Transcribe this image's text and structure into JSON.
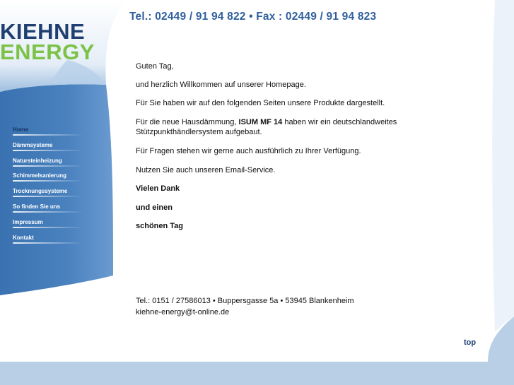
{
  "header": {
    "phone_fax": "Tel.: 02449 / 91 94 822  • Fax : 02449 / 91 94 823"
  },
  "logo": {
    "line1": "KIEHNE",
    "line2": "ENERGY"
  },
  "nav": {
    "items": [
      {
        "label": "Home"
      },
      {
        "label": "Dämmsysteme"
      },
      {
        "label": "Natursteinheizung"
      },
      {
        "label": "Schimmelsanierung"
      },
      {
        "label": "Trocknungssysteme"
      },
      {
        "label": "So finden Sie uns"
      },
      {
        "label": "Impressum"
      },
      {
        "label": "Kontakt"
      }
    ]
  },
  "content": {
    "greeting": "Guten Tag,",
    "welcome": "und herzlich Willkommen auf unserer Homepage.",
    "products": "Für Sie haben wir auf den folgenden Seiten unsere Produkte dargestellt.",
    "insulation_pre": "Für die neue Hausdämmung, ",
    "insulation_product": "ISUM MF 14",
    "insulation_post": " haben wir ein deutschlandweites Stützpunkthändlersystem aufgebaut.",
    "questions": "Für Fragen stehen wir gerne auch ausführlich zu Ihrer Verfügung.",
    "email_service": "Nutzen Sie auch unseren Email-Service.",
    "thanks": "Vielen Dank",
    "and_a": "und einen",
    "nice_day": "schönen Tag"
  },
  "footer": {
    "address": "Tel.: 0151 / 27586013 • Buppersgasse 5a • 53945 Blankenheim",
    "email": "kiehne-energy@t-online.de"
  },
  "top_link": "top",
  "colors": {
    "accent_blue": "#2f5f9c",
    "logo_dark": "#1f3f70",
    "logo_green": "#7bc247",
    "sidebar_blue": "#3f77b4",
    "page_bg": "#b9cfe6"
  }
}
